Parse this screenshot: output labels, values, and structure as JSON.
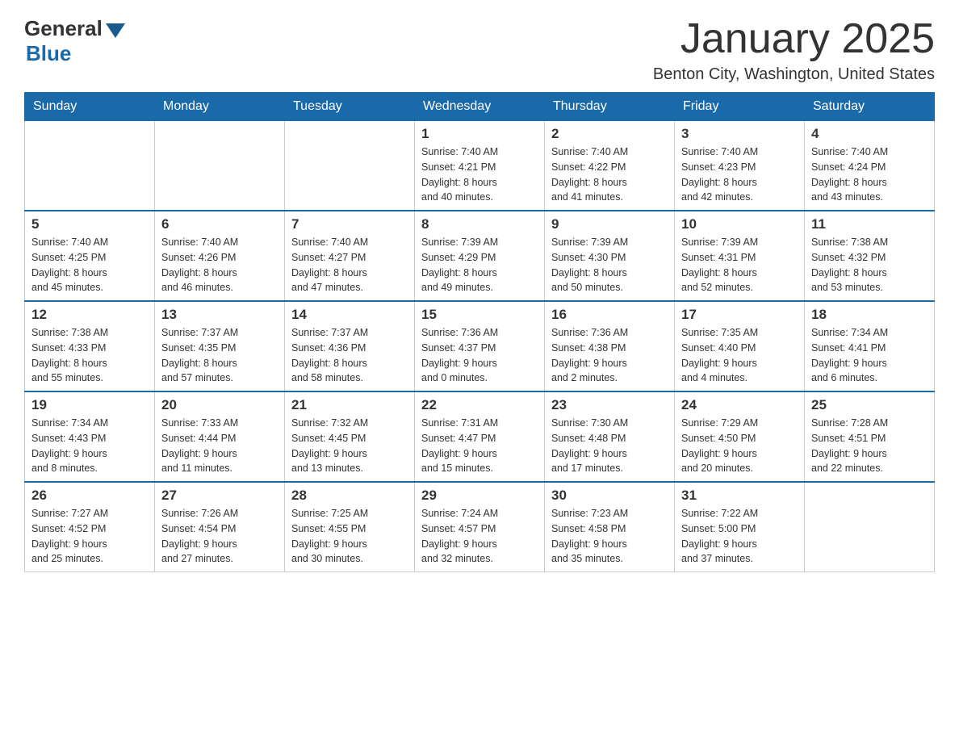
{
  "logo": {
    "general": "General",
    "blue": "Blue"
  },
  "title": "January 2025",
  "location": "Benton City, Washington, United States",
  "days_of_week": [
    "Sunday",
    "Monday",
    "Tuesday",
    "Wednesday",
    "Thursday",
    "Friday",
    "Saturday"
  ],
  "weeks": [
    [
      {
        "day": "",
        "info": ""
      },
      {
        "day": "",
        "info": ""
      },
      {
        "day": "",
        "info": ""
      },
      {
        "day": "1",
        "info": "Sunrise: 7:40 AM\nSunset: 4:21 PM\nDaylight: 8 hours\nand 40 minutes."
      },
      {
        "day": "2",
        "info": "Sunrise: 7:40 AM\nSunset: 4:22 PM\nDaylight: 8 hours\nand 41 minutes."
      },
      {
        "day": "3",
        "info": "Sunrise: 7:40 AM\nSunset: 4:23 PM\nDaylight: 8 hours\nand 42 minutes."
      },
      {
        "day": "4",
        "info": "Sunrise: 7:40 AM\nSunset: 4:24 PM\nDaylight: 8 hours\nand 43 minutes."
      }
    ],
    [
      {
        "day": "5",
        "info": "Sunrise: 7:40 AM\nSunset: 4:25 PM\nDaylight: 8 hours\nand 45 minutes."
      },
      {
        "day": "6",
        "info": "Sunrise: 7:40 AM\nSunset: 4:26 PM\nDaylight: 8 hours\nand 46 minutes."
      },
      {
        "day": "7",
        "info": "Sunrise: 7:40 AM\nSunset: 4:27 PM\nDaylight: 8 hours\nand 47 minutes."
      },
      {
        "day": "8",
        "info": "Sunrise: 7:39 AM\nSunset: 4:29 PM\nDaylight: 8 hours\nand 49 minutes."
      },
      {
        "day": "9",
        "info": "Sunrise: 7:39 AM\nSunset: 4:30 PM\nDaylight: 8 hours\nand 50 minutes."
      },
      {
        "day": "10",
        "info": "Sunrise: 7:39 AM\nSunset: 4:31 PM\nDaylight: 8 hours\nand 52 minutes."
      },
      {
        "day": "11",
        "info": "Sunrise: 7:38 AM\nSunset: 4:32 PM\nDaylight: 8 hours\nand 53 minutes."
      }
    ],
    [
      {
        "day": "12",
        "info": "Sunrise: 7:38 AM\nSunset: 4:33 PM\nDaylight: 8 hours\nand 55 minutes."
      },
      {
        "day": "13",
        "info": "Sunrise: 7:37 AM\nSunset: 4:35 PM\nDaylight: 8 hours\nand 57 minutes."
      },
      {
        "day": "14",
        "info": "Sunrise: 7:37 AM\nSunset: 4:36 PM\nDaylight: 8 hours\nand 58 minutes."
      },
      {
        "day": "15",
        "info": "Sunrise: 7:36 AM\nSunset: 4:37 PM\nDaylight: 9 hours\nand 0 minutes."
      },
      {
        "day": "16",
        "info": "Sunrise: 7:36 AM\nSunset: 4:38 PM\nDaylight: 9 hours\nand 2 minutes."
      },
      {
        "day": "17",
        "info": "Sunrise: 7:35 AM\nSunset: 4:40 PM\nDaylight: 9 hours\nand 4 minutes."
      },
      {
        "day": "18",
        "info": "Sunrise: 7:34 AM\nSunset: 4:41 PM\nDaylight: 9 hours\nand 6 minutes."
      }
    ],
    [
      {
        "day": "19",
        "info": "Sunrise: 7:34 AM\nSunset: 4:43 PM\nDaylight: 9 hours\nand 8 minutes."
      },
      {
        "day": "20",
        "info": "Sunrise: 7:33 AM\nSunset: 4:44 PM\nDaylight: 9 hours\nand 11 minutes."
      },
      {
        "day": "21",
        "info": "Sunrise: 7:32 AM\nSunset: 4:45 PM\nDaylight: 9 hours\nand 13 minutes."
      },
      {
        "day": "22",
        "info": "Sunrise: 7:31 AM\nSunset: 4:47 PM\nDaylight: 9 hours\nand 15 minutes."
      },
      {
        "day": "23",
        "info": "Sunrise: 7:30 AM\nSunset: 4:48 PM\nDaylight: 9 hours\nand 17 minutes."
      },
      {
        "day": "24",
        "info": "Sunrise: 7:29 AM\nSunset: 4:50 PM\nDaylight: 9 hours\nand 20 minutes."
      },
      {
        "day": "25",
        "info": "Sunrise: 7:28 AM\nSunset: 4:51 PM\nDaylight: 9 hours\nand 22 minutes."
      }
    ],
    [
      {
        "day": "26",
        "info": "Sunrise: 7:27 AM\nSunset: 4:52 PM\nDaylight: 9 hours\nand 25 minutes."
      },
      {
        "day": "27",
        "info": "Sunrise: 7:26 AM\nSunset: 4:54 PM\nDaylight: 9 hours\nand 27 minutes."
      },
      {
        "day": "28",
        "info": "Sunrise: 7:25 AM\nSunset: 4:55 PM\nDaylight: 9 hours\nand 30 minutes."
      },
      {
        "day": "29",
        "info": "Sunrise: 7:24 AM\nSunset: 4:57 PM\nDaylight: 9 hours\nand 32 minutes."
      },
      {
        "day": "30",
        "info": "Sunrise: 7:23 AM\nSunset: 4:58 PM\nDaylight: 9 hours\nand 35 minutes."
      },
      {
        "day": "31",
        "info": "Sunrise: 7:22 AM\nSunset: 5:00 PM\nDaylight: 9 hours\nand 37 minutes."
      },
      {
        "day": "",
        "info": ""
      }
    ]
  ]
}
